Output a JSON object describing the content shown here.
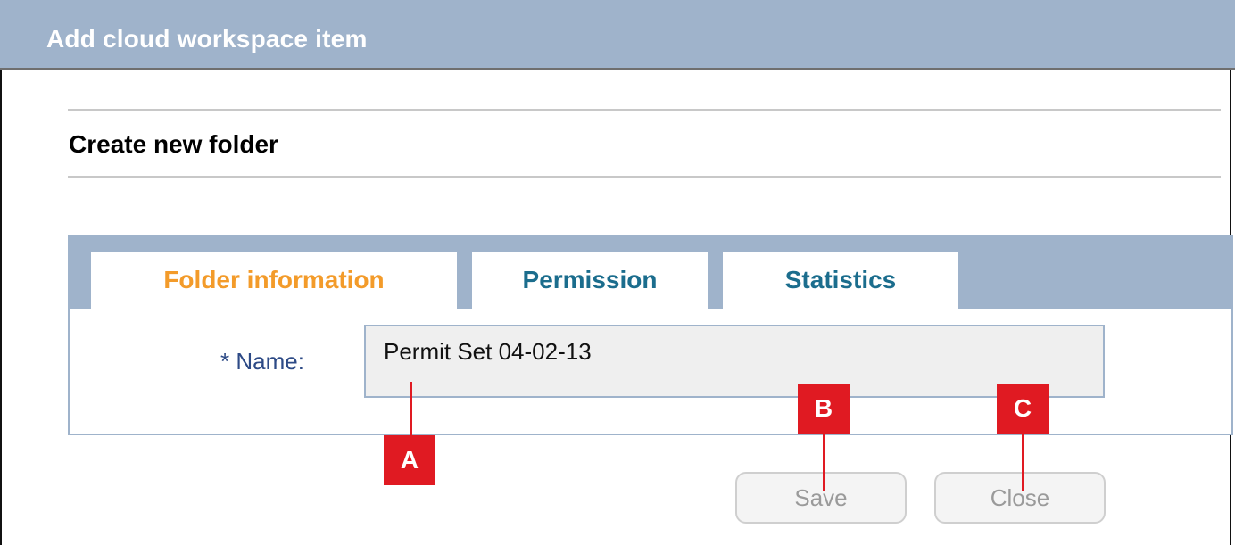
{
  "window": {
    "title": "Add cloud workspace item"
  },
  "section": {
    "title": "Create new folder"
  },
  "tabs": [
    {
      "label": "Folder information",
      "active": true
    },
    {
      "label": "Permission",
      "active": false
    },
    {
      "label": "Statistics",
      "active": false
    }
  ],
  "form": {
    "name_label": "* Name:",
    "name_value": "Permit Set 04-02-13"
  },
  "buttons": {
    "save": "Save",
    "close": "Close",
    "enabled": false
  },
  "callouts": [
    "A",
    "B",
    "C"
  ],
  "colors": {
    "titlebar": "#9fb3cb",
    "active_tab": "#f39b2a",
    "inactive_tab": "#1b6d8d",
    "label": "#2d4a86",
    "callout": "#e01a22"
  }
}
